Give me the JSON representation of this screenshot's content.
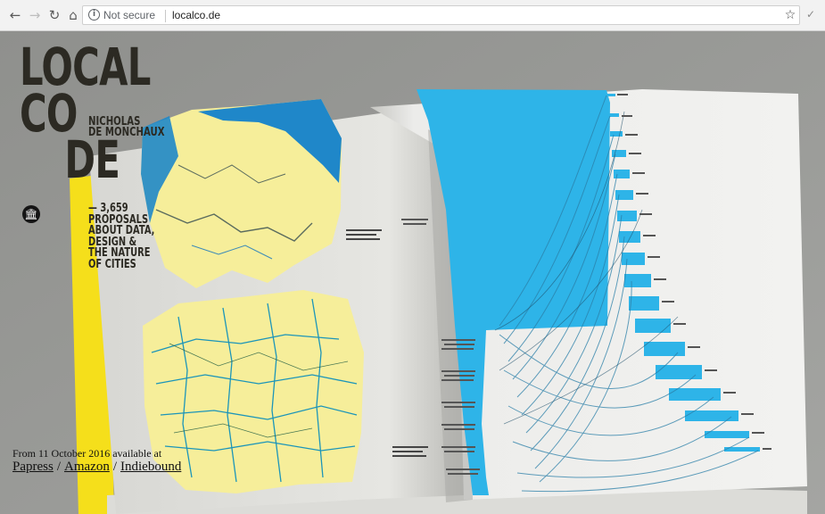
{
  "browser": {
    "url": "localco.de",
    "security_label": "Not secure",
    "icons": {
      "back": "arrow-left-icon",
      "forward": "arrow-right-icon",
      "reload": "reload-icon",
      "home": "home-icon",
      "info": "info-icon",
      "bookmark": "star-icon",
      "extension": "checkmark-icon"
    }
  },
  "hero": {
    "logo_lines": [
      "LOCAL",
      "CO",
      "DE"
    ],
    "author_lines": [
      "NICHOLAS",
      "DE MONCHAUX"
    ],
    "tagline_lines": [
      "— 3,659",
      "PROPOSALS",
      "ABOUT DATA,",
      "DESIGN &",
      "THE NATURE",
      "OF CITIES"
    ],
    "museum_icon": "museum-icon"
  },
  "availability": {
    "text": "From 11 October 2016 available at",
    "stores": [
      "Papress",
      "Amazon",
      "Indiebound"
    ],
    "separator": "/"
  },
  "colors": {
    "background": "#9c9d9a",
    "book_yellow": "#f5df1b",
    "flow_blue": "#2eb4e8",
    "map_yellow": "#f6ee9a",
    "text_dark": "#2c2a23"
  }
}
